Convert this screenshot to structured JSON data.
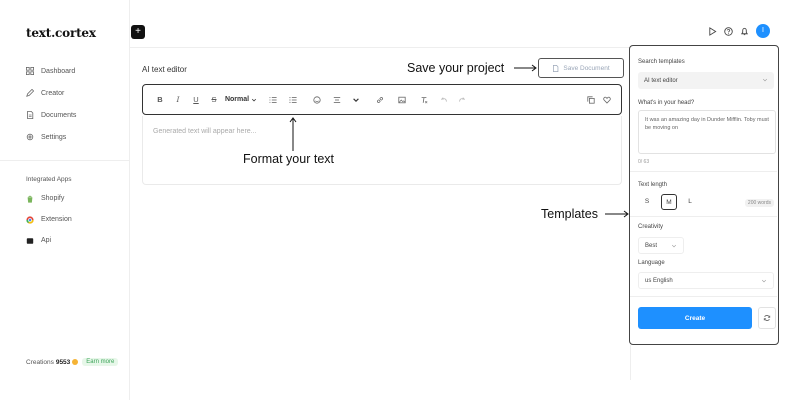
{
  "app": {
    "logo": "text.cortex"
  },
  "sidebar": {
    "items": [
      {
        "label": "Dashboard",
        "icon": "grid-icon"
      },
      {
        "label": "Creator",
        "icon": "pen-icon"
      },
      {
        "label": "Documents",
        "icon": "document-icon"
      },
      {
        "label": "Settings",
        "icon": "gear-icon"
      }
    ],
    "section_title": "Integrated Apps",
    "apps": [
      {
        "label": "Shopify",
        "icon": "shopify-icon",
        "color": "#7ab55c"
      },
      {
        "label": "Extension",
        "icon": "chrome-icon",
        "color": "#e4473a"
      },
      {
        "label": "Api",
        "icon": "api-icon",
        "color": "#222222"
      }
    ],
    "credits": {
      "label": "Creations",
      "value": "9553",
      "earn_label": "Earn more"
    }
  },
  "topbar": {
    "plus_label": "+",
    "avatar_initial": "I"
  },
  "editor": {
    "title": "AI text editor",
    "save_label": "Save Document",
    "toolbar": {
      "format_label": "Normal"
    },
    "placeholder": "Generated text will appear here..."
  },
  "annotations": {
    "save": "Save your project",
    "format": "Format your text",
    "templates": "Templates"
  },
  "panel": {
    "search_label": "Search templates",
    "template_value": "AI text editor",
    "prompt_label": "What's in your head?",
    "prompt_value": "It was an amazing day in Dunder Mifflin. Toby must be moving on",
    "counter": "0/ 63",
    "length_label": "Text length",
    "length_options": [
      "S",
      "M",
      "L"
    ],
    "length_selected": "M",
    "words": "200 words",
    "creativity_label": "Creativity",
    "creativity_value": "Best",
    "language_label": "Language",
    "language_value": "us English",
    "create_label": "Create"
  },
  "colors": {
    "accent": "#1e90ff",
    "border": "#333333"
  }
}
